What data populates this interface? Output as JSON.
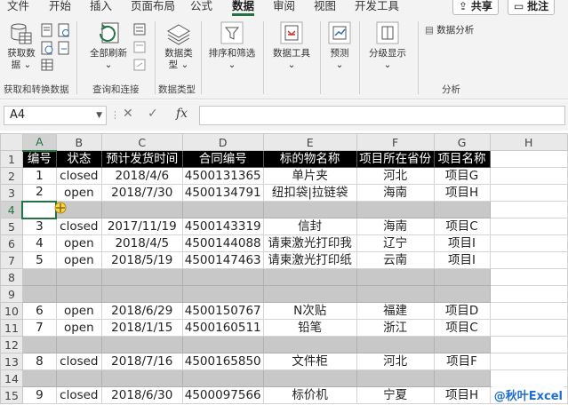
{
  "ribbon_tabs": [
    "文件",
    "开始",
    "插入",
    "页面布局",
    "公式",
    "数据",
    "审阅",
    "视图",
    "开发工具"
  ],
  "active_tab": "数据",
  "share_label": "共享",
  "comments_label": "批注",
  "groups": {
    "get": {
      "btn_label_1": "获取数",
      "btn_label_2": "据",
      "group_label": "获取和转换数据"
    },
    "refresh": {
      "btn_label": "全部刷新",
      "group_label": "查询和连接"
    },
    "types": {
      "btn_label_1": "数据类",
      "btn_label_2": "型",
      "group_label": "数据类型"
    },
    "sort": {
      "btn_label": "排序和筛选"
    },
    "tools": {
      "btn_label": "数据工具"
    },
    "forecast": {
      "btn_label": "预测"
    },
    "outline": {
      "btn_label": "分级显示"
    },
    "analysis": {
      "btn_label": "数据分析",
      "group_label": "分析"
    }
  },
  "name_box": "A4",
  "column_headers": [
    "A",
    "B",
    "C",
    "D",
    "E",
    "F",
    "G",
    "H"
  ],
  "table_header": [
    "编号",
    "状态",
    "预计发货时间",
    "合同编号",
    "标的物名称",
    "项目所在省份",
    "项目名称"
  ],
  "rows": [
    {
      "num": "2",
      "cells": [
        "1",
        "closed",
        "2018/4/6",
        "4500131365",
        "单片夹",
        "河北",
        "项目G"
      ]
    },
    {
      "num": "3",
      "cells": [
        "2",
        "open",
        "2018/7/30",
        "4500134791",
        "纽扣袋|拉链袋",
        "海南",
        "项目H"
      ]
    },
    {
      "num": "4",
      "cells": [
        "",
        "",
        "",
        "",
        "",
        "",
        ""
      ],
      "blank": true
    },
    {
      "num": "5",
      "cells": [
        "3",
        "closed",
        "2017/11/19",
        "4500143319",
        "信封",
        "海南",
        "项目C"
      ]
    },
    {
      "num": "6",
      "cells": [
        "4",
        "open",
        "2018/4/5",
        "4500144088",
        "请柬激光打印我",
        "辽宁",
        "项目I"
      ]
    },
    {
      "num": "7",
      "cells": [
        "5",
        "open",
        "2018/5/19",
        "4500147463",
        "请柬激光打印纸",
        "云南",
        "项目I"
      ]
    },
    {
      "num": "8",
      "cells": [
        "",
        "",
        "",
        "",
        "",
        "",
        ""
      ],
      "blank": true
    },
    {
      "num": "9",
      "cells": [
        "",
        "",
        "",
        "",
        "",
        "",
        ""
      ],
      "blank": true
    },
    {
      "num": "10",
      "cells": [
        "6",
        "open",
        "2018/6/29",
        "4500150767",
        "N次贴",
        "福建",
        "项目D"
      ]
    },
    {
      "num": "11",
      "cells": [
        "7",
        "open",
        "2018/1/15",
        "4500160511",
        "铅笔",
        "浙江",
        "项目C"
      ]
    },
    {
      "num": "12",
      "cells": [
        "",
        "",
        "",
        "",
        "",
        "",
        ""
      ],
      "blank": true
    },
    {
      "num": "13",
      "cells": [
        "8",
        "closed",
        "2018/7/16",
        "4500165850",
        "文件柜",
        "河北",
        "项目F"
      ]
    },
    {
      "num": "14",
      "cells": [
        "",
        "",
        "",
        "",
        "",
        "",
        ""
      ],
      "blank": true
    },
    {
      "num": "15",
      "cells": [
        "9",
        "closed",
        "2018/6/30",
        "4500097566",
        "标价机",
        "宁夏",
        "项目H"
      ]
    }
  ],
  "header_row_num": "1",
  "watermark": "@秋叶Excel",
  "colors": {
    "accent": "#217346",
    "header_bg": "#000000",
    "blank_row_bg": "#c8c8c8"
  }
}
